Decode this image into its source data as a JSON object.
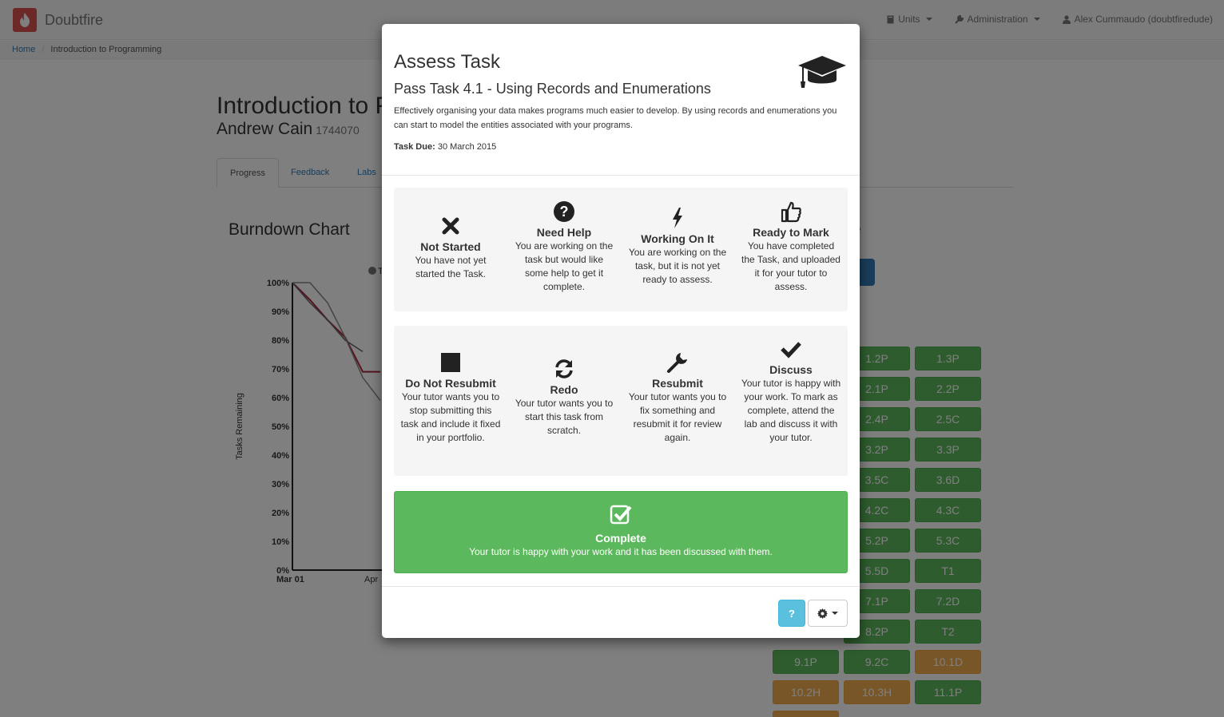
{
  "navbar": {
    "brand": "Doubtfire",
    "menus": [
      {
        "label": "Units"
      },
      {
        "label": "Administration"
      },
      {
        "label": "Alex Cummaudo (doubtfiredude)"
      }
    ]
  },
  "breadcrumb": {
    "home": "Home",
    "current": "Introduction to Programming"
  },
  "page": {
    "unit_title": "Introduction to P",
    "student_name": "Andrew Cain",
    "student_id": "1744070",
    "tabs": [
      "Progress",
      "Feedback",
      "Labs"
    ],
    "burndown_title": "Burndown Chart",
    "right_title_fragment": "e",
    "task_tiles": [
      {
        "label": "1.2P",
        "status": "green"
      },
      {
        "label": "1.3P",
        "status": "green"
      },
      {
        "label": "2.1P",
        "status": "green"
      },
      {
        "label": "2.2P",
        "status": "green"
      },
      {
        "label": "2.4P",
        "status": "green"
      },
      {
        "label": "2.5C",
        "status": "green"
      },
      {
        "label": "3.2P",
        "status": "green"
      },
      {
        "label": "3.3P",
        "status": "green"
      },
      {
        "label": "3.5C",
        "status": "green"
      },
      {
        "label": "3.6D",
        "status": "green"
      },
      {
        "label": "4.2C",
        "status": "green"
      },
      {
        "label": "4.3C",
        "status": "green"
      },
      {
        "label": "5.2P",
        "status": "green"
      },
      {
        "label": "5.3C",
        "status": "green"
      },
      {
        "label": "5.5D",
        "status": "green"
      },
      {
        "label": "T1",
        "status": "green"
      },
      {
        "label": "7.1P",
        "status": "green"
      },
      {
        "label": "7.2D",
        "status": "green"
      },
      {
        "label": "8.2P",
        "status": "green"
      },
      {
        "label": "T2",
        "status": "green"
      },
      {
        "label": "9.1P",
        "status": "green"
      },
      {
        "label": "9.2C",
        "status": "green"
      },
      {
        "label": "10.1D",
        "status": "orange"
      },
      {
        "label": "10.2H",
        "status": "orange"
      },
      {
        "label": "10.3H",
        "status": "orange"
      },
      {
        "label": "11.1P",
        "status": "green"
      }
    ]
  },
  "chart_data": {
    "type": "line",
    "title": "",
    "ylabel": "Tasks Remaining",
    "yticks": [
      "0%",
      "10%",
      "20%",
      "30%",
      "40%",
      "50%",
      "60%",
      "70%",
      "80%",
      "90%",
      "100%"
    ],
    "xticks": [
      "Mar 01",
      "Apr"
    ],
    "ylim": [
      0,
      100
    ],
    "series": [
      {
        "color": "#b0263f",
        "values": [
          100,
          94,
          87,
          81,
          69,
          69
        ]
      },
      {
        "color": "#666666",
        "values": [
          100,
          93,
          87,
          80,
          76
        ]
      },
      {
        "color": "#888888",
        "values": [
          100,
          100,
          93,
          81,
          67,
          59
        ]
      }
    ],
    "legend_fragment": "T"
  },
  "modal": {
    "title": "Assess Task",
    "subtitle": "Pass Task 4.1 - Using Records and Enumerations",
    "description": "Effectively organising your data makes programs much easier to develop. By using records and enumerations you can start to model the entities associated with your programs.",
    "due_label": "Task Due:",
    "due_date": "30 March 2015",
    "statuses_row1": [
      {
        "icon": "x-icon",
        "label": "Not Started",
        "text": "You have not yet started the Task."
      },
      {
        "icon": "question-circle-icon",
        "label": "Need Help",
        "text": "You are working on the task but would like some help to get it complete."
      },
      {
        "icon": "bolt-icon",
        "label": "Working On It",
        "text": "You are working on the task, but it is not yet ready to assess."
      },
      {
        "icon": "thumbs-up-icon",
        "label": "Ready to Mark",
        "text": "You have completed the Task, and uploaded it for your tutor to assess."
      }
    ],
    "statuses_row2": [
      {
        "icon": "stop-square-icon",
        "label": "Do Not Resubmit",
        "text": "Your tutor wants you to stop submitting this task and include it fixed in your portfolio."
      },
      {
        "icon": "refresh-icon",
        "label": "Redo",
        "text": "Your tutor wants you to start this task from scratch."
      },
      {
        "icon": "wrench-icon",
        "label": "Resubmit",
        "text": "Your tutor wants you to fix something and resubmit it for review again."
      },
      {
        "icon": "check-icon",
        "label": "Discuss",
        "text": "Your tutor is happy with your work. To mark as complete, attend the lab and discuss it with your tutor."
      }
    ],
    "complete": {
      "icon": "check-square-icon",
      "label": "Complete",
      "text": "Your tutor is happy with your work and it has been discussed with them."
    },
    "footer": {
      "help_label": "?"
    }
  }
}
